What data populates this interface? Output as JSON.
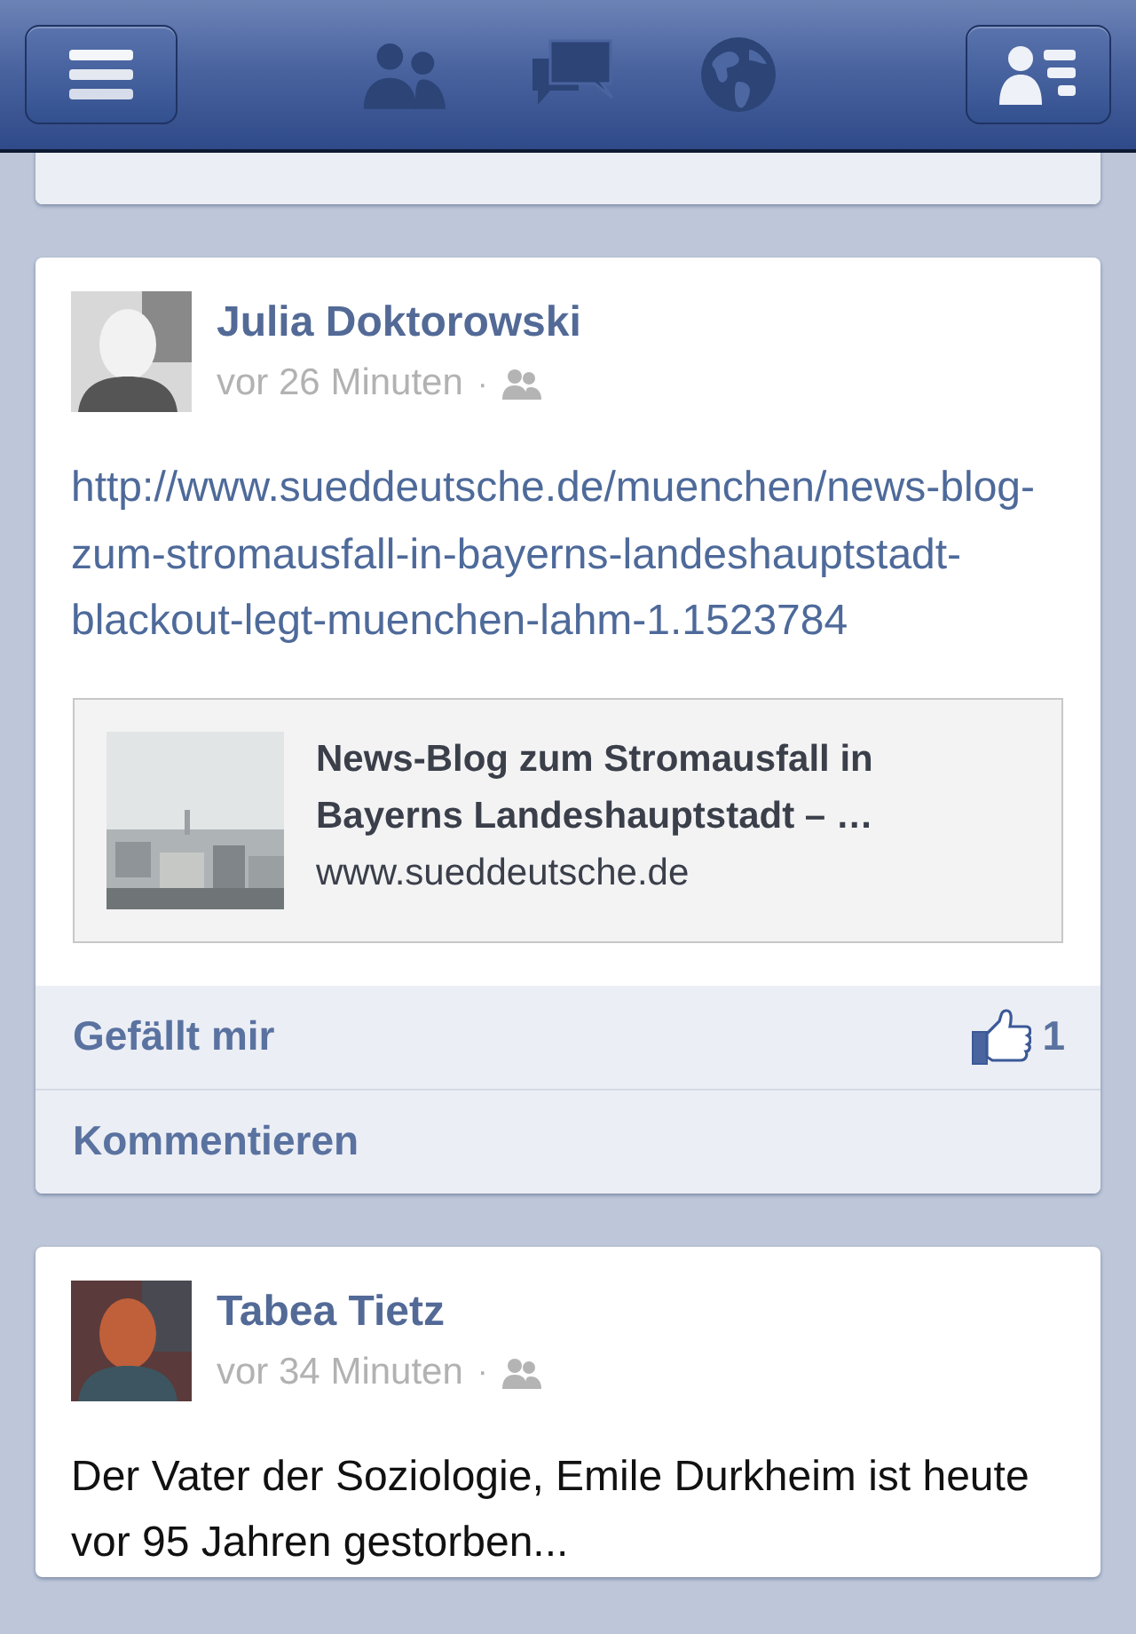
{
  "nav_bar": {
    "buttons": [
      {
        "kind": "menu"
      },
      {
        "kind": "friends"
      },
      {
        "kind": "messages"
      },
      {
        "kind": "notifications"
      },
      {
        "kind": "contacts"
      }
    ]
  },
  "feed": [
    {
      "kind": "stub"
    },
    {
      "kind": "link",
      "author": "Julia Doktorowski",
      "time": "vor 26 Minuten",
      "separator": "·",
      "text": "http://www.sueddeutsche.de/muenchen/news-blog-zum-stromausfall-in-bayerns-landeshauptstadt-blackout-legt-muenchen-lahm-1.1523784",
      "preview": {
        "title": "News-Blog zum Stromausfall in Bayerns Landeshauptstadt – …",
        "domain": "www.sueddeutsche.de"
      },
      "actions": {
        "like_label": "Gefällt mir",
        "like_count": "1",
        "comment_label": "Kommentieren"
      }
    },
    {
      "kind": "text",
      "author": "Tabea Tietz",
      "time": "vor 34 Minuten",
      "separator": "·",
      "text": "Der Vater der Soziologie, Emile Durkheim ist heute vor 95 Jahren gestorben..."
    }
  ]
}
